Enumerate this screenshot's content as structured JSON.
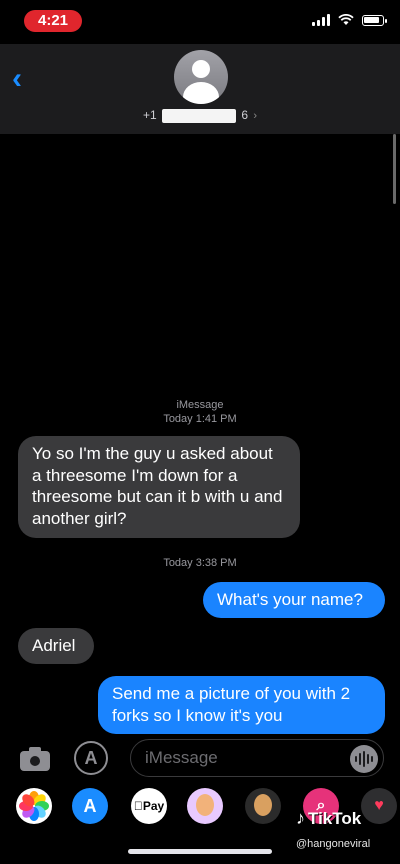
{
  "status_bar": {
    "time": "4:21"
  },
  "header": {
    "contact_prefix": "+1",
    "contact_suffix": "6"
  },
  "thread": {
    "service_label": "iMessage",
    "first_timestamp": "Today 1:41 PM",
    "second_timestamp": "Today 3:38 PM",
    "messages": [
      {
        "direction": "received",
        "text": "Yo so I'm the guy u asked about a threesome I'm down for a threesome but can it b with u and another girl?"
      },
      {
        "direction": "sent",
        "text": "What's your name?"
      },
      {
        "direction": "received",
        "text": "Adriel"
      },
      {
        "direction": "sent",
        "text": "Send me a picture of you with 2 forks so I know it's you"
      }
    ]
  },
  "composer": {
    "placeholder": "iMessage"
  },
  "app_drawer": {
    "items": [
      {
        "icon": "photos-icon"
      },
      {
        "icon": "app-store-icon",
        "glyph": "A"
      },
      {
        "icon": "apple-pay-icon",
        "label": "Pay"
      },
      {
        "icon": "memoji-icon"
      },
      {
        "icon": "animoji-icon"
      },
      {
        "icon": "search-images-icon",
        "glyph": "⌕"
      },
      {
        "icon": "heart-app-icon",
        "glyph": "♥"
      }
    ]
  },
  "watermark": {
    "brand": "TikTok",
    "handle": "@hangoneviral"
  },
  "colors": {
    "sent_bubble": "#1a84ff",
    "received_bubble": "#3a3a3c",
    "time_pill": "#e0262d"
  }
}
